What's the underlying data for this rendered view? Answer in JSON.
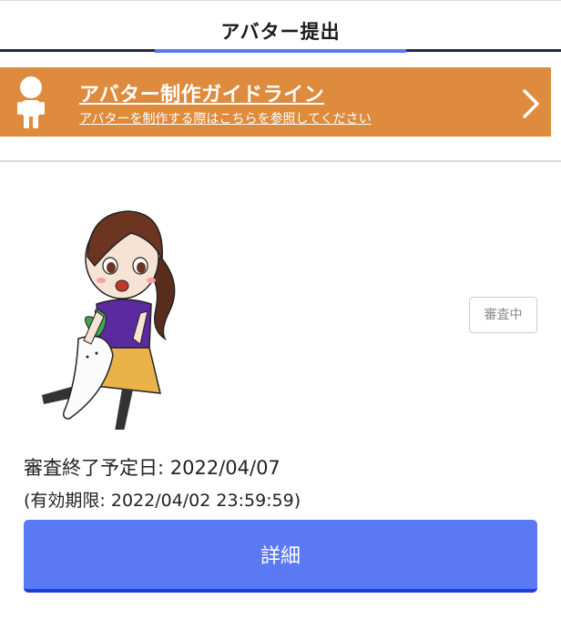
{
  "header": {
    "title": "アバター提出"
  },
  "guide_banner": {
    "title": "アバター制作ガイドライン",
    "subtitle": "アバターを制作する際はこちらを参照してください",
    "background": "#de8b3d",
    "icons": [
      "person-icon",
      "chevron-right-icon"
    ]
  },
  "submission": {
    "status": "審査中",
    "review_end_date": "審査終了予定日: 2022/04/07",
    "expiry": "(有効期限: 2022/04/02 23:59:59)"
  },
  "actions": {
    "detail_label": "詳細",
    "detail_color": "#5c79f4"
  }
}
